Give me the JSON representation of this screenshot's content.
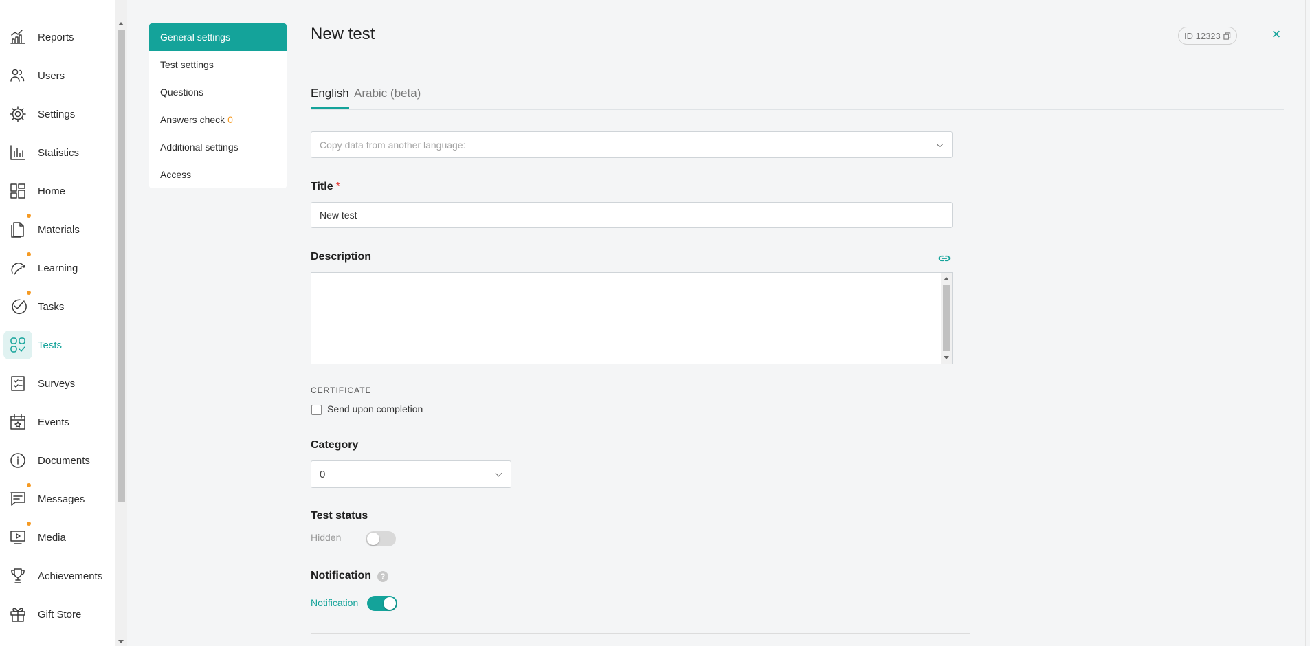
{
  "nav": {
    "items": [
      {
        "label": "Reports",
        "icon": "reports-icon",
        "dot": false,
        "active": false
      },
      {
        "label": "Users",
        "icon": "users-icon",
        "dot": false,
        "active": false
      },
      {
        "label": "Settings",
        "icon": "gear-icon",
        "dot": false,
        "active": false
      },
      {
        "label": "Statistics",
        "icon": "statistics-icon",
        "dot": false,
        "active": false
      },
      {
        "label": "Home",
        "icon": "home-grid-icon",
        "dot": false,
        "active": false
      },
      {
        "label": "Materials",
        "icon": "materials-icon",
        "dot": true,
        "active": false
      },
      {
        "label": "Learning",
        "icon": "learning-icon",
        "dot": true,
        "active": false
      },
      {
        "label": "Tasks",
        "icon": "tasks-check-icon",
        "dot": true,
        "active": false
      },
      {
        "label": "Tests",
        "icon": "tests-icon",
        "dot": false,
        "active": true
      },
      {
        "label": "Surveys",
        "icon": "surveys-icon",
        "dot": false,
        "active": false
      },
      {
        "label": "Events",
        "icon": "events-calendar-icon",
        "dot": false,
        "active": false
      },
      {
        "label": "Documents",
        "icon": "documents-info-icon",
        "dot": false,
        "active": false
      },
      {
        "label": "Messages",
        "icon": "messages-icon",
        "dot": true,
        "active": false
      },
      {
        "label": "Media",
        "icon": "media-icon",
        "dot": true,
        "active": false
      },
      {
        "label": "Achievements",
        "icon": "trophy-icon",
        "dot": false,
        "active": false
      },
      {
        "label": "Gift Store",
        "icon": "gift-icon",
        "dot": false,
        "active": false
      }
    ]
  },
  "submenu": {
    "items": [
      {
        "label": "General settings",
        "active": true,
        "count": ""
      },
      {
        "label": "Test settings",
        "active": false,
        "count": ""
      },
      {
        "label": "Questions",
        "active": false,
        "count": ""
      },
      {
        "label": "Answers check",
        "active": false,
        "count": "0"
      },
      {
        "label": "Additional settings",
        "active": false,
        "count": ""
      },
      {
        "label": "Access",
        "active": false,
        "count": ""
      }
    ]
  },
  "header": {
    "title": "New test",
    "id_label": "ID 12323",
    "close": "×"
  },
  "tabs": [
    {
      "label": "English",
      "active": true
    },
    {
      "label": "Arabic (beta)",
      "active": false
    }
  ],
  "form": {
    "copy_placeholder": "Copy data from another language:",
    "title_label": "Title",
    "title_required": "*",
    "title_value": "New test",
    "description_label": "Description",
    "certificate_heading": "CERTIFICATE",
    "send_upon_completion": "Send upon completion",
    "category_label": "Category",
    "category_value": "0",
    "status_label": "Test status",
    "status_toggle_label": "Hidden",
    "status_on": false,
    "notification_label": "Notification",
    "notification_help": "?",
    "notification_toggle_label": "Notification",
    "notification_on": true
  },
  "colors": {
    "accent": "#14a39a",
    "dot": "#f59a23",
    "required": "#e53935"
  }
}
